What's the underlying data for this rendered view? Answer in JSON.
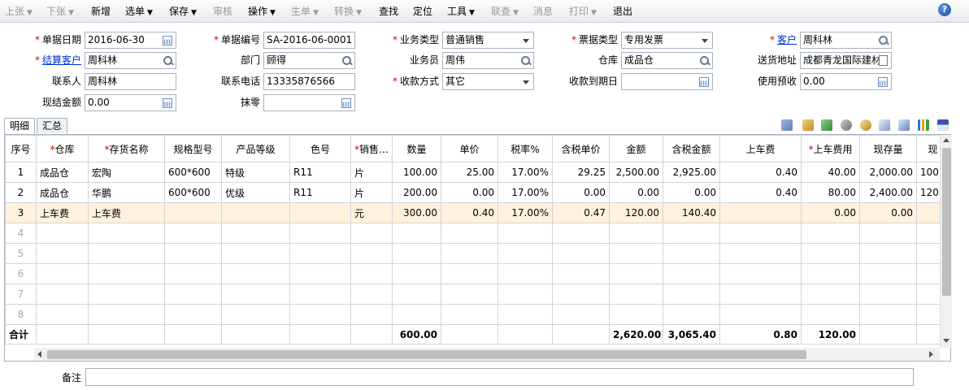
{
  "toolbar": {
    "items": [
      {
        "label": "上张",
        "disabled": true,
        "dropdown": true
      },
      {
        "label": "下张",
        "disabled": true,
        "dropdown": true
      },
      {
        "label": "新增",
        "disabled": false,
        "dropdown": false
      },
      {
        "label": "选单",
        "disabled": false,
        "dropdown": true
      },
      {
        "label": "保存",
        "disabled": false,
        "dropdown": true
      },
      {
        "label": "审核",
        "disabled": true,
        "dropdown": false
      },
      {
        "label": "操作",
        "disabled": false,
        "dropdown": true
      },
      {
        "label": "生单",
        "disabled": true,
        "dropdown": true
      },
      {
        "label": "转换",
        "disabled": true,
        "dropdown": true
      },
      {
        "label": "查找",
        "disabled": false,
        "dropdown": false
      },
      {
        "label": "定位",
        "disabled": false,
        "dropdown": false
      },
      {
        "label": "工具",
        "disabled": false,
        "dropdown": true
      },
      {
        "label": "联查",
        "disabled": true,
        "dropdown": true
      },
      {
        "label": "消息",
        "disabled": true,
        "dropdown": false
      },
      {
        "label": "打印",
        "disabled": true,
        "dropdown": true
      },
      {
        "label": "退出",
        "disabled": false,
        "dropdown": false
      }
    ],
    "caret": "▼",
    "help": "?"
  },
  "form": {
    "doc_date": {
      "label": "单据日期",
      "value": "2016-06-30"
    },
    "doc_no": {
      "label": "单据编号",
      "value": "SA-2016-06-0001"
    },
    "biz_type": {
      "label": "业务类型",
      "value": "普通销售"
    },
    "invoice_type": {
      "label": "票据类型",
      "value": "专用发票"
    },
    "customer": {
      "label": "客户",
      "value": "周科林"
    },
    "settle_customer": {
      "label": "结算客户",
      "value": "周科林"
    },
    "dept": {
      "label": "部门",
      "value": "顾得"
    },
    "salesman": {
      "label": "业务员",
      "value": "周伟"
    },
    "warehouse": {
      "label": "仓库",
      "value": "成品仓"
    },
    "ship_addr": {
      "label": "送货地址",
      "value": "成都青龙国际建材"
    },
    "contact": {
      "label": "联系人",
      "value": "周科林"
    },
    "phone": {
      "label": "联系电话",
      "value": "13335876566"
    },
    "pay_method": {
      "label": "收款方式",
      "value": "其它"
    },
    "due_date": {
      "label": "收款到期日",
      "value": ""
    },
    "prepay": {
      "label": "使用预收",
      "value": "0.00"
    },
    "cash_amount": {
      "label": "现结金额",
      "value": "0.00"
    },
    "rounding": {
      "label": "抹零",
      "value": ""
    }
  },
  "tabs": [
    "明细",
    "汇总"
  ],
  "grid": {
    "headers": [
      "序号",
      "仓库",
      "存货名称",
      "规格型号",
      "产品等级",
      "色号",
      "销售…",
      "数量",
      "单价",
      "税率%",
      "含税单价",
      "金额",
      "含税金额",
      "上车费",
      "上车费用",
      "现存量",
      "现"
    ],
    "rows": [
      [
        "1",
        "成品仓",
        "宏陶",
        "600*600",
        "特级",
        "R11",
        "片",
        "100.00",
        "25.00",
        "17.00%",
        "29.25",
        "2,500.00",
        "2,925.00",
        "0.40",
        "40.00",
        "2,000.00",
        "100"
      ],
      [
        "2",
        "成品仓",
        "华鹏",
        "600*600",
        "优级",
        "R11",
        "片",
        "200.00",
        "0.00",
        "17.00%",
        "0.00",
        "0.00",
        "0.00",
        "0.40",
        "80.00",
        "2,400.00",
        "120"
      ],
      [
        "3",
        "上车费",
        "上车费",
        "",
        "",
        "",
        "元",
        "300.00",
        "0.40",
        "17.00%",
        "0.47",
        "120.00",
        "140.40",
        "",
        "0.00",
        "0.00",
        ""
      ]
    ],
    "empty_rows": [
      "4",
      "5",
      "6",
      "7",
      "8"
    ],
    "total": {
      "label": "合计",
      "qty": "600.00",
      "amount": "2,620.00",
      "tax_amount": "3,065.40",
      "fee": "0.80",
      "fee_total": "120.00"
    }
  },
  "memo": {
    "label": "备注",
    "value": ""
  }
}
